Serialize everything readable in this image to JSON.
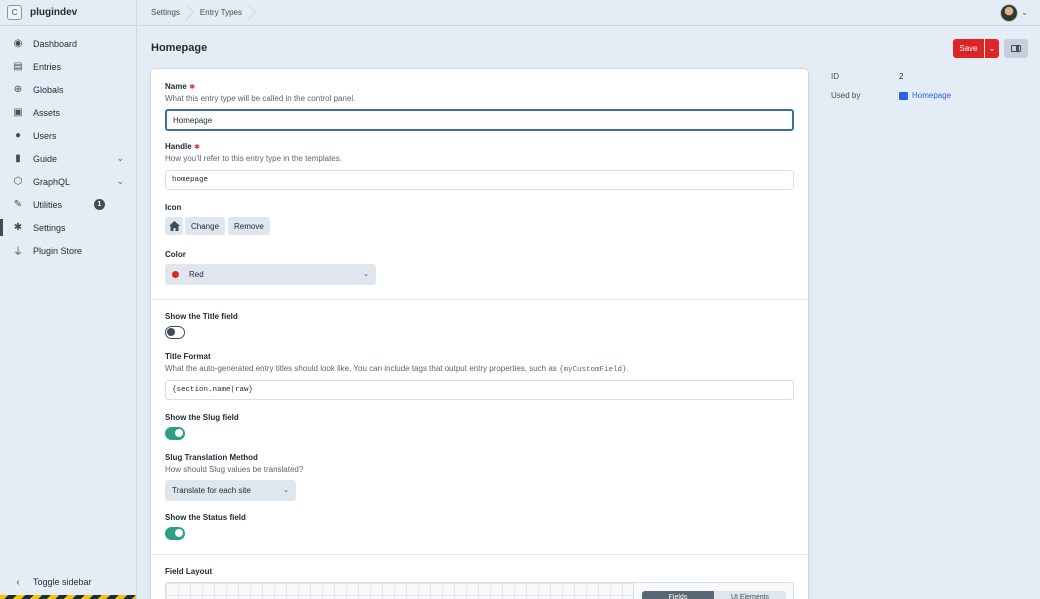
{
  "sidebar": {
    "site_initial": "C",
    "site_name": "plugindev",
    "items": [
      {
        "label": "Dashboard",
        "icon": "dashboard-icon"
      },
      {
        "label": "Entries",
        "icon": "entries-icon"
      },
      {
        "label": "Globals",
        "icon": "globe-icon"
      },
      {
        "label": "Assets",
        "icon": "image-icon"
      },
      {
        "label": "Users",
        "icon": "users-icon"
      },
      {
        "label": "Guide",
        "icon": "book-icon",
        "has_submenu": true
      },
      {
        "label": "GraphQL",
        "icon": "graphql-icon",
        "has_submenu": true
      },
      {
        "label": "Utilities",
        "icon": "wrench-icon",
        "badge": "1"
      },
      {
        "label": "Settings",
        "icon": "gear-icon",
        "active": true
      },
      {
        "label": "Plugin Store",
        "icon": "plug-icon"
      }
    ],
    "toggle_label": "Toggle sidebar"
  },
  "breadcrumbs": [
    "Settings",
    "Entry Types"
  ],
  "page": {
    "title": "Homepage",
    "save_label": "Save"
  },
  "form": {
    "name": {
      "label": "Name",
      "hint": "What this entry type will be called in the control panel.",
      "value": "Homepage"
    },
    "handle": {
      "label": "Handle",
      "hint": "How you’ll refer to this entry type in the templates.",
      "value": "homepage"
    },
    "icon": {
      "label": "Icon",
      "current": "house-icon",
      "change_label": "Change",
      "remove_label": "Remove"
    },
    "color": {
      "label": "Color",
      "value": "Red",
      "swatch": "#dc2626"
    },
    "show_title": {
      "label": "Show the Title field",
      "enabled": false
    },
    "title_format": {
      "label": "Title Format",
      "hint": "What the auto-generated entry titles should look like. You can include tags that output entry properties, such as ",
      "hint_code": "{myCustomField}",
      "hint_end": ".",
      "value": "{section.name|raw}"
    },
    "show_slug": {
      "label": "Show the Slug field",
      "enabled": true
    },
    "slug_translation": {
      "label": "Slug Translation Method",
      "hint": "How should Slug values be translated?",
      "value": "Translate for each site"
    },
    "show_status": {
      "label": "Show the Status field",
      "enabled": true
    },
    "field_layout": {
      "label": "Field Layout",
      "tabs": [
        "Fields",
        "UI Elements"
      ]
    }
  },
  "meta": {
    "id_label": "ID",
    "id_value": "2",
    "used_by_label": "Used by",
    "used_by_value": "Homepage"
  },
  "colors": {
    "accent": "#dc2626",
    "toggle_on": "#2e9e85",
    "link": "#2563eb",
    "focus": "#3a6ea5"
  }
}
